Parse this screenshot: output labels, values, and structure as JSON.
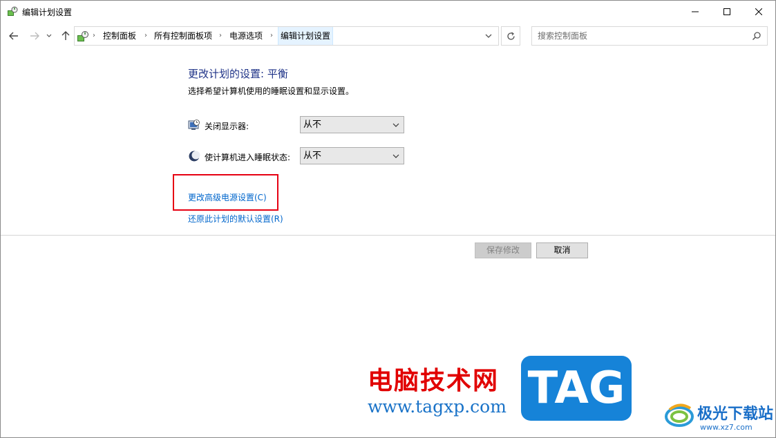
{
  "window": {
    "title": "编辑计划设置",
    "icon": "power-options-icon"
  },
  "address_bar": {
    "breadcrumbs": [
      "控制面板",
      "所有控制面板项",
      "电源选项",
      "编辑计划设置"
    ]
  },
  "search": {
    "placeholder": "搜索控制面板"
  },
  "content": {
    "heading": "更改计划的设置: 平衡",
    "subtitle": "选择希望计算机使用的睡眠设置和显示设置。",
    "settings": [
      {
        "label": "关闭显示器:",
        "value": "从不",
        "icon": "display-icon"
      },
      {
        "label": "使计算机进入睡眠状态:",
        "value": "从不",
        "icon": "sleep-moon-icon"
      }
    ],
    "links": {
      "advanced": "更改高级电源设置(C)",
      "restore": "还原此计划的默认设置(R)"
    },
    "buttons": {
      "save": "保存修改",
      "cancel": "取消"
    }
  },
  "watermark": {
    "site_name": "电脑技术网",
    "site_url": "www.tagxp.com",
    "tag_text": "TAG",
    "logo_name": "极光下载站",
    "logo_url": "www.xz7.com"
  },
  "colors": {
    "heading": "#1e3287",
    "link": "#0066cc",
    "highlight_box": "#e60012"
  }
}
